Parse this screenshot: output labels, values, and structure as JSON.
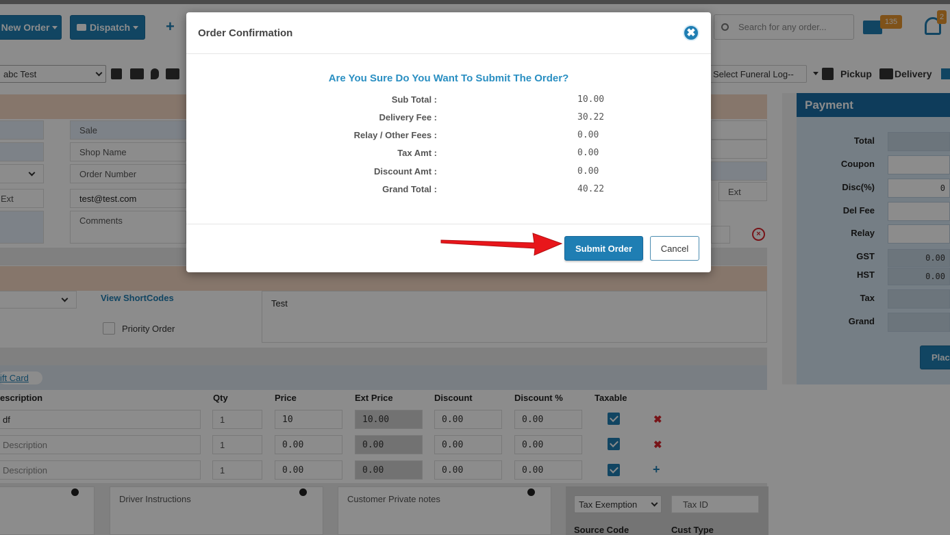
{
  "topbar": {
    "new_order": "New Order",
    "dispatch": "Dispatch",
    "plus": "+",
    "search_placeholder": "Search for any order...",
    "mail_badge": "135",
    "bell_badge": "2"
  },
  "toolbar": {
    "store_select": "abc Test",
    "funeral_select": "Select Funeral Log--",
    "pickup": "Pickup",
    "delivery": "Delivery"
  },
  "form": {
    "sale": "Sale",
    "shop_name": "Shop Name",
    "order_number": "Order Number",
    "ext_left": "Ext",
    "email": "test@test.com",
    "comments": "Comments",
    "ext_right": "Ext",
    "view_shortcodes": "View ShortCodes",
    "priority_order": "Priority Order",
    "message": "Test",
    "gift_card": "ift Card"
  },
  "items": {
    "headers": [
      "escription",
      "Qty",
      "Price",
      "Ext Price",
      "Discount",
      "Discount %",
      "Taxable"
    ],
    "rows": [
      {
        "desc": "df",
        "qty": "1",
        "price": "10",
        "ext": "10.00",
        "disc": "0.00",
        "discpct": "0.00",
        "action": "✖"
      },
      {
        "desc": "Description",
        "qty": "1",
        "price": "0.00",
        "ext": "0.00",
        "disc": "0.00",
        "discpct": "0.00",
        "action": "✖"
      },
      {
        "desc": "Description",
        "qty": "1",
        "price": "0.00",
        "ext": "0.00",
        "disc": "0.00",
        "discpct": "0.00",
        "action": "+"
      }
    ]
  },
  "bottom": {
    "driver_instructions": "Driver Instructions",
    "customer_private_notes": "Customer Private notes",
    "tax_exemption": "Tax Exemption",
    "tax_id": "Tax ID",
    "source_code": "Source Code",
    "cust_type": "Cust Type"
  },
  "payment": {
    "title": "Payment",
    "rows": [
      {
        "label": "Total",
        "value": ""
      },
      {
        "label": "Coupon",
        "value": ""
      },
      {
        "label": "Disc(%)",
        "value": "0"
      },
      {
        "label": "Del Fee",
        "value": ""
      },
      {
        "label": "Relay",
        "value": ""
      },
      {
        "label": "GST",
        "value": "0.00"
      },
      {
        "label": "HST",
        "value": "0.00"
      },
      {
        "label": "Tax",
        "value": ""
      },
      {
        "label": "Grand",
        "value": ""
      }
    ],
    "place_button": "Plac"
  },
  "modal": {
    "title": "Order Confirmation",
    "close": "✖",
    "question": "Are You Sure Do You Want To Submit The Order?",
    "summary": [
      {
        "label": "Sub Total :",
        "value": "10.00"
      },
      {
        "label": "Delivery Fee :",
        "value": "30.22"
      },
      {
        "label": "Relay / Other Fees :",
        "value": "0.00"
      },
      {
        "label": "Tax Amt :",
        "value": "0.00"
      },
      {
        "label": "Discount Amt :",
        "value": "0.00"
      },
      {
        "label": "Grand Total :",
        "value": "40.22"
      }
    ],
    "submit": "Submit Order",
    "cancel": "Cancel"
  },
  "colors": {
    "primary": "#1f7eb3",
    "question": "#2a8fc2",
    "arrow": "#e8161b",
    "badge": "#e8952e"
  }
}
